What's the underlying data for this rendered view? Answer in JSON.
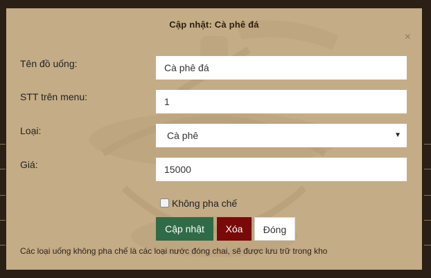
{
  "modal": {
    "title": "Cập nhật: Cà phê đá",
    "close_symbol": "×"
  },
  "form": {
    "name_label": "Tên đồ uống:",
    "name_value": "Cà phê đá",
    "order_label": "STT trên menu:",
    "order_value": "1",
    "type_label": "Loại:",
    "type_value": "Cà phê",
    "price_label": "Giá:",
    "price_value": "15000",
    "no_prep_label": "Không pha chế"
  },
  "buttons": {
    "update": "Cập nhật",
    "delete": "Xóa",
    "close": "Đóng"
  },
  "note": "Các loại uống không pha chế là các loại nước đóng chai, sẽ được lưu trữ trong kho",
  "colors": {
    "modal_bg": "#c4ac86",
    "update_btn": "#2f6b46",
    "delete_btn": "#7a0a0a"
  }
}
